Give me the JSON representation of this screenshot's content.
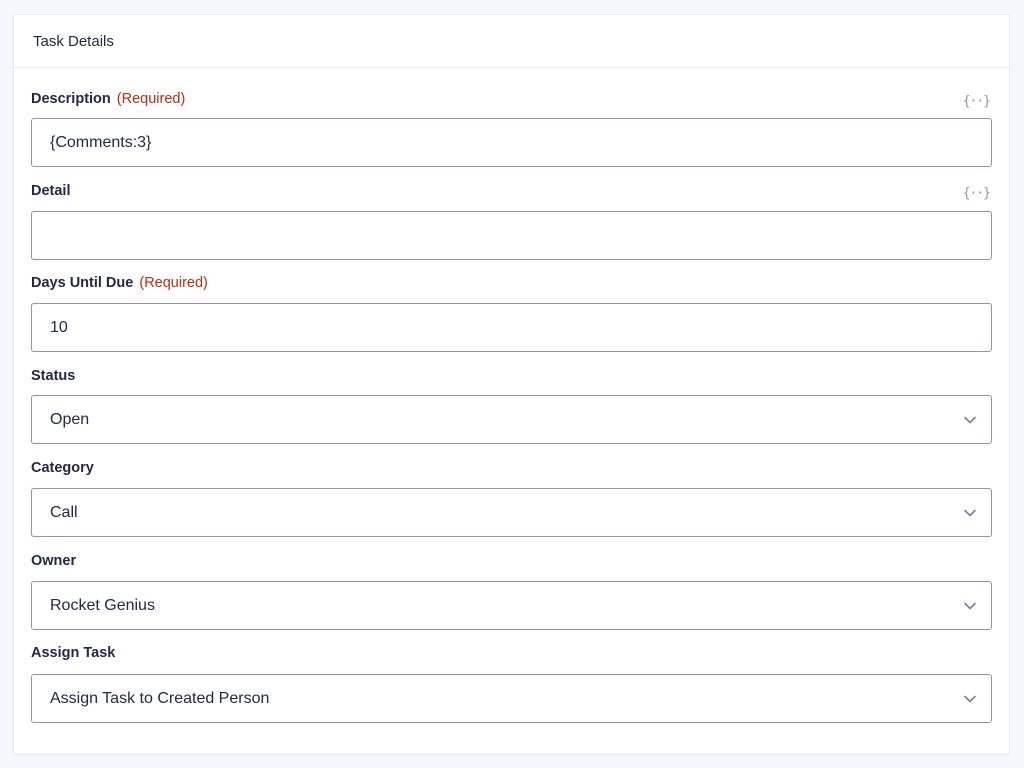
{
  "panel": {
    "title": "Task Details"
  },
  "required_text": "(Required)",
  "merge_tag_icon": "{··}",
  "fields": {
    "description": {
      "label": "Description",
      "value": "{Comments:3}"
    },
    "detail": {
      "label": "Detail",
      "value": ""
    },
    "days_until_due": {
      "label": "Days Until Due",
      "value": "10"
    },
    "status": {
      "label": "Status",
      "selected": "Open"
    },
    "category": {
      "label": "Category",
      "selected": "Call"
    },
    "owner": {
      "label": "Owner",
      "selected": "Rocket Genius"
    },
    "assign_task": {
      "label": "Assign Task",
      "selected": "Assign Task to Created Person"
    }
  },
  "colors": {
    "required": "#c02b0a",
    "border": "#9092b2",
    "text": "#242748"
  }
}
